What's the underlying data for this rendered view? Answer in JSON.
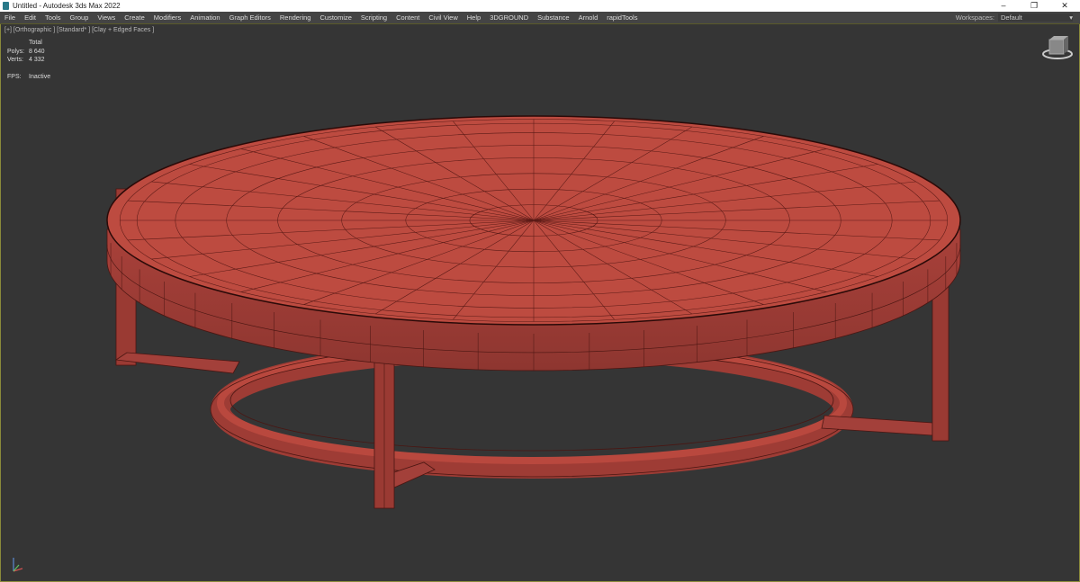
{
  "window": {
    "title": "Untitled - Autodesk 3ds Max 2022",
    "minimize": "–",
    "restore": "❐",
    "close": "✕"
  },
  "menu": [
    "File",
    "Edit",
    "Tools",
    "Group",
    "Views",
    "Create",
    "Modifiers",
    "Animation",
    "Graph Editors",
    "Rendering",
    "Customize",
    "Scripting",
    "Content",
    "Civil View",
    "Help",
    "3DGROUND",
    "Substance",
    "Arnold",
    "rapidTools"
  ],
  "workspaces": {
    "label": "Workspaces:",
    "value": "Default"
  },
  "viewport": {
    "label": "[+] [Orthographic ] [Standard* ] [Clay + Edged Faces ]",
    "stats": {
      "header": "Total",
      "polys_label": "Polys:",
      "polys": "8 640",
      "verts_label": "Verts:",
      "verts": "4 332",
      "fps_label": "FPS:",
      "fps": "Inactive"
    },
    "model_color": "#b9483e",
    "wire_color": "#5a1a16"
  }
}
